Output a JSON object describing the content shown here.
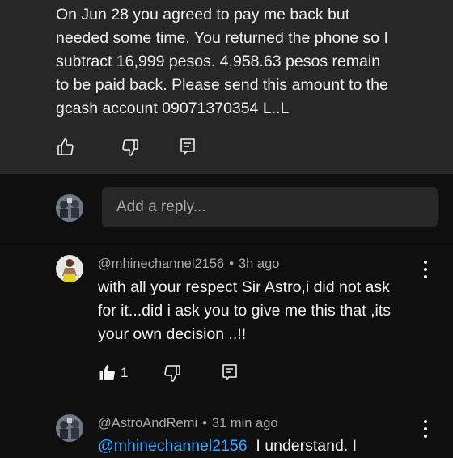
{
  "top_comment": {
    "text": "On Jun 28 you agreed to pay me back but\nneeded some time. You returned the phone so I\nsubtract 16,999 pesos. 4,958.63 pesos remain\nto be paid back. Please send this amount to the\ngcash account 09071370354 L..L"
  },
  "reply_input": {
    "placeholder": "Add a reply..."
  },
  "comments": [
    {
      "author": "@mhinechannel2156",
      "time": "3h ago",
      "text": "with all your respect Sir Astro,i did not ask\nfor it...did i ask you to give me this that ,its\nyour own decision ..!!",
      "likes": "1"
    },
    {
      "author": "@AstroAndRemi",
      "time": "31 min ago",
      "mention": "@mhinechannel2156",
      "text_after_mention": "  I understand. I"
    }
  ],
  "separator": "•",
  "colors": {
    "background": "#0f0f0f",
    "card": "#272727",
    "text": "#f1f1f1",
    "secondary_text": "#aaaaaa",
    "mention": "#3ea6ff"
  },
  "icons": [
    "thumbs-up-icon",
    "thumbs-down-icon",
    "reply-icon",
    "more-vert-icon"
  ]
}
